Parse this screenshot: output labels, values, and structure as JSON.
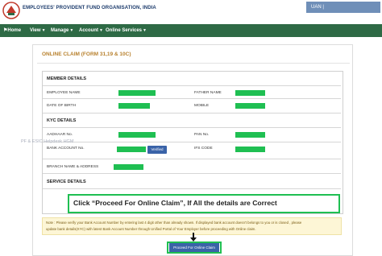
{
  "header": {
    "org_name": "EMPLOYEES' PROVIDENT FUND ORGANISATION, INDIA",
    "login_label": "UAN |"
  },
  "nav": {
    "home": "Home",
    "view": "View",
    "manage": "Manage",
    "account": "Account",
    "online_services": "Online Services"
  },
  "page": {
    "title": "ONLINE CLAIM (FORM 31,19 & 10C)"
  },
  "member_details": {
    "heading": "MEMBER DETAILS",
    "employee_name": "EMPLOYEE NAME",
    "father_name": "FATHER NAME",
    "date_of_birth": "DATE OF BIRTH",
    "mobile": "MOBILE"
  },
  "kyc_details": {
    "heading": "KYC DETAILS",
    "aadhaar": "AADHAAR No.",
    "pan": "PAN No.",
    "bank_account": "BANK ACCOUNT No.",
    "ifs_code": "IFS CODE",
    "verified_badge": "Verified",
    "branch": "BRANCH NAME & ADDRESS"
  },
  "service_details": {
    "heading": "SERVICE DETAILS"
  },
  "watermark": "PF & ESIC Helpdesk HGM",
  "callout": "Click “Proceed For Online Claim”, If All the details are Correct",
  "note": {
    "line1": "Note : Please verify your Bank Account Number by entering last 4 digit other than already shown. If displayed bank account doesn't belongs to you or is closed , please",
    "line2": "update bank details(KYC) with latest Bank Account Number through Unified Portal of Your Employer before proceeding with Online claim."
  },
  "proceed_button": "Proceed For Online Claim",
  "colors": {
    "nav_green": "#2e6a45",
    "highlight_green": "#1fbf52",
    "button_blue": "#3a63a8",
    "title_orange": "#b8812e"
  }
}
